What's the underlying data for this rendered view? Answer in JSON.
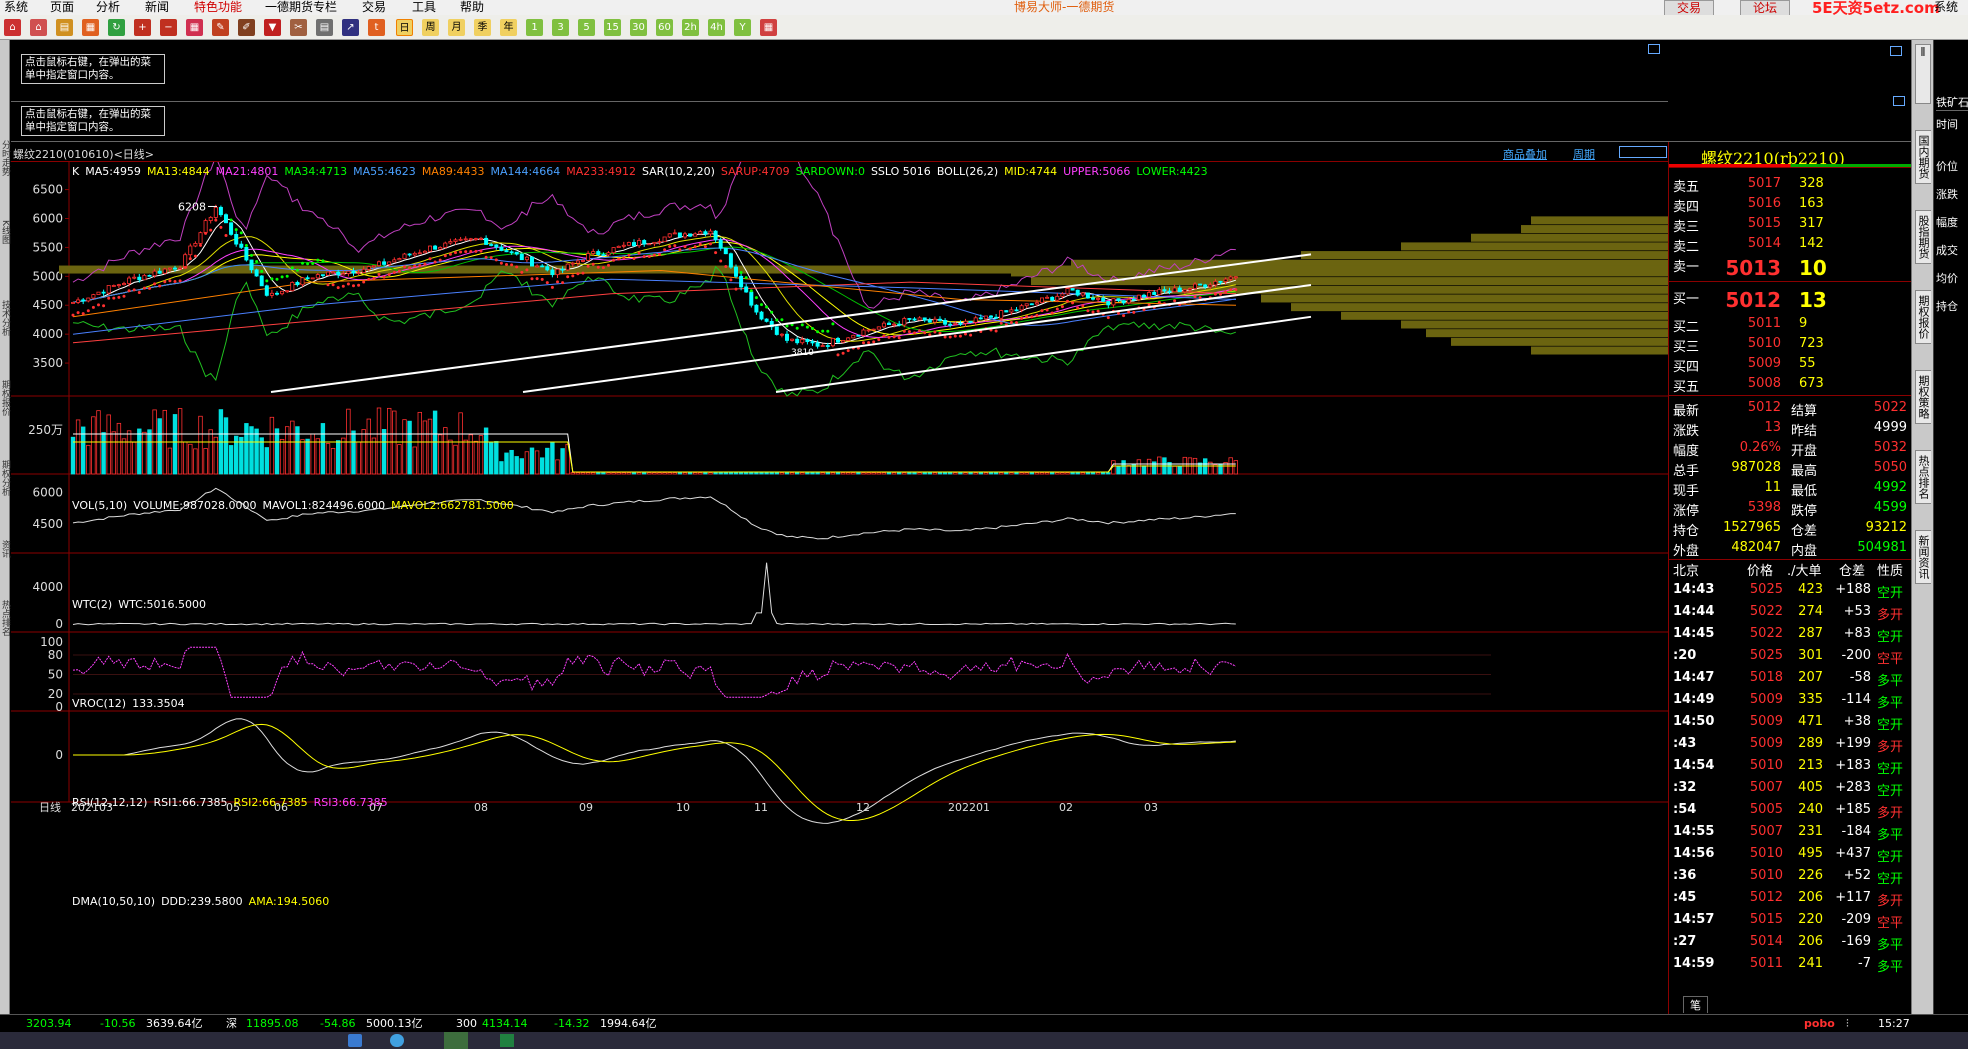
{
  "menu": [
    "系统",
    "页面",
    "分析",
    "新闻",
    "特色功能",
    "一德期货专栏",
    "交易",
    "工具",
    "帮助"
  ],
  "app_title": "博易大师-一德期货",
  "trade_btn": "交易",
  "forum_btn": "论坛",
  "watermark": "5E天资5etz.com",
  "system_right": "系统",
  "toolbar_periods": [
    "日",
    "周",
    "月",
    "季",
    "年",
    "1",
    "3",
    "5",
    "15",
    "30",
    "60",
    "2h",
    "4h",
    "Y"
  ],
  "notes": [
    "点击鼠标右键，在弹出的菜单中指定窗口内容。",
    "点击鼠标右键，在弹出的菜单中指定窗口内容。"
  ],
  "chart_header": {
    "symbol": "螺纹2210(010610)<日线>",
    "add_product": "商品叠加",
    "period": "周期"
  },
  "left_tabs": [
    "分时走势",
    "K线图",
    "技术分析",
    "期权报价",
    "期权分析",
    "资讯",
    "热点排名"
  ],
  "right_tabs": [
    "国内期货",
    "股指期货",
    "期权报价",
    "期权策略",
    "热点排名",
    "新闻资讯"
  ],
  "far_right": {
    "top": "铁矿石",
    "items": [
      "时间",
      "价位",
      "涨跌",
      "幅度",
      "成交",
      "均价",
      "持仓"
    ]
  },
  "colors": {
    "up": "#ff3030",
    "down": "#00ffff",
    "ma5": "#ffffff",
    "ma13": "#ffff00",
    "ma21": "#ff40ff",
    "ma34": "#00ff00",
    "ma55": "#4aa0ff",
    "ma89": "#ff8000",
    "ma144": "#4aa0ff",
    "ma233": "#ff3030"
  },
  "main_legend": [
    {
      "t": "K",
      "c": "wht"
    },
    {
      "t": "MA5:4959",
      "c": "wht"
    },
    {
      "t": "MA13:4844",
      "c": "yel"
    },
    {
      "t": "MA21:4801",
      "c": "mag"
    },
    {
      "t": "MA34:4713",
      "c": "grn"
    },
    {
      "t": "MA55:4623",
      "c": "blu"
    },
    {
      "t": "MA89:4433",
      "c": "org"
    },
    {
      "t": "MA144:4664",
      "c": "blu"
    },
    {
      "t": "MA233:4912",
      "c": "red"
    },
    {
      "t": "SAR(10,2,20)",
      "c": "wht"
    },
    {
      "t": "SARUP:4709",
      "c": "red"
    },
    {
      "t": "SARDOWN:0",
      "c": "grn"
    },
    {
      "t": "SSLO 5016",
      "c": "wht"
    },
    {
      "t": "BOLL(26,2)",
      "c": "wht"
    },
    {
      "t": "MID:4744",
      "c": "yel"
    },
    {
      "t": "UPPER:5066",
      "c": "mag"
    },
    {
      "t": "LOWER:4423",
      "c": "grn"
    }
  ],
  "vol_legend": [
    {
      "t": "VOL(5,10)",
      "c": "wht"
    },
    {
      "t": "VOLUME:987028.0000",
      "c": "wht"
    },
    {
      "t": "MAVOL1:824496.6000",
      "c": "wht"
    },
    {
      "t": "MAVOL2:662781.5000",
      "c": "yel"
    }
  ],
  "wtc_legend": [
    {
      "t": "WTC(2)",
      "c": "wht"
    },
    {
      "t": "WTC:5016.5000",
      "c": "wht"
    }
  ],
  "vroc_legend": [
    {
      "t": "VROC(12)",
      "c": "wht"
    },
    {
      "t": "133.3504",
      "c": "wht"
    }
  ],
  "rsi_legend": [
    {
      "t": "RSI(12,12,12)",
      "c": "wht"
    },
    {
      "t": "RSI1:66.7385",
      "c": "wht"
    },
    {
      "t": "RSI2:66.7385",
      "c": "yel"
    },
    {
      "t": "RSI3:66.7385",
      "c": "mag"
    }
  ],
  "dma_legend": [
    {
      "t": "DMA(10,50,10)",
      "c": "wht"
    },
    {
      "t": "DDD:239.5800",
      "c": "wht"
    },
    {
      "t": "AMA:194.5060",
      "c": "yel"
    }
  ],
  "y_main": [
    "6500",
    "6000",
    "5500",
    "5000",
    "4500",
    "4000",
    "3500"
  ],
  "y_vol": [
    "250万"
  ],
  "y_wtc": [
    "6000",
    "4500"
  ],
  "y_vroc": [
    "4000",
    "0"
  ],
  "y_rsi": [
    "100",
    "80",
    "50",
    "20",
    "0"
  ],
  "y_dma": [
    "0"
  ],
  "peak_label": "6208",
  "low_label": "3810",
  "x_label": "日线",
  "x_ticks": [
    "202103",
    "05",
    "06",
    "07",
    "08",
    "09",
    "10",
    "11",
    "12",
    "202201",
    "02",
    "03"
  ],
  "chart_data": {
    "type": "candlestick",
    "ylim": [
      3000,
      6700
    ],
    "x": [
      "202103",
      "05",
      "06",
      "07",
      "08",
      "09",
      "10",
      "11",
      "12",
      "202201",
      "02",
      "03"
    ],
    "close": [
      4950,
      5750,
      4900,
      5250,
      5450,
      5300,
      5750,
      3900,
      4250,
      4500,
      4750,
      5012
    ],
    "high": [
      5050,
      6208,
      5300,
      5400,
      5600,
      5500,
      5950,
      4900,
      4400,
      4650,
      4900,
      5050
    ],
    "low": [
      4500,
      4850,
      4600,
      5000,
      5100,
      5000,
      4700,
      3810,
      3900,
      4200,
      4450,
      4650
    ]
  },
  "quote": {
    "title": "螺纹2210(rb2210)",
    "asks": [
      {
        "l": "卖五",
        "p": "5017",
        "v": "328"
      },
      {
        "l": "卖四",
        "p": "5016",
        "v": "163"
      },
      {
        "l": "卖三",
        "p": "5015",
        "v": "317"
      },
      {
        "l": "卖二",
        "p": "5014",
        "v": "142"
      },
      {
        "l": "卖一",
        "p": "5013",
        "v": "10"
      }
    ],
    "bids": [
      {
        "l": "买一",
        "p": "5012",
        "v": "13"
      },
      {
        "l": "买二",
        "p": "5011",
        "v": "9"
      },
      {
        "l": "买三",
        "p": "5010",
        "v": "723"
      },
      {
        "l": "买四",
        "p": "5009",
        "v": "55"
      },
      {
        "l": "买五",
        "p": "5008",
        "v": "673"
      }
    ],
    "stats": [
      [
        "最新",
        "5012",
        "结算",
        "5022"
      ],
      [
        "涨跌",
        "13",
        "昨结",
        "4999"
      ],
      [
        "幅度",
        "0.26%",
        "开盘",
        "5032"
      ],
      [
        "总手",
        "987028",
        "最高",
        "5050"
      ],
      [
        "现手",
        "11",
        "最低",
        "4992"
      ],
      [
        "涨停",
        "5398",
        "跌停",
        "4599"
      ],
      [
        "持仓",
        "1527965",
        "仓差",
        "93212"
      ],
      [
        "外盘",
        "482047",
        "内盘",
        "504981"
      ]
    ],
    "tick_header": [
      "北京",
      "价格",
      "./大单",
      "仓差",
      "性质"
    ],
    "ticks": [
      [
        "14:43",
        "5025",
        "423",
        "+188",
        "空开"
      ],
      [
        "14:44",
        "5022",
        "274",
        "+53",
        "多开"
      ],
      [
        "14:45",
        "5022",
        "287",
        "+83",
        "空开"
      ],
      [
        ":20",
        "5025",
        "301",
        "-200",
        "空平"
      ],
      [
        "14:47",
        "5018",
        "207",
        "-58",
        "多平"
      ],
      [
        "14:49",
        "5009",
        "335",
        "-114",
        "多平"
      ],
      [
        "14:50",
        "5009",
        "471",
        "+38",
        "空开"
      ],
      [
        ":43",
        "5009",
        "289",
        "+199",
        "多开"
      ],
      [
        "14:54",
        "5010",
        "213",
        "+183",
        "空开"
      ],
      [
        ":32",
        "5007",
        "405",
        "+283",
        "空开"
      ],
      [
        ":54",
        "5005",
        "240",
        "+185",
        "多开"
      ],
      [
        "14:55",
        "5007",
        "231",
        "-184",
        "多平"
      ],
      [
        "14:56",
        "5010",
        "495",
        "+437",
        "空开"
      ],
      [
        ":36",
        "5010",
        "226",
        "+52",
        "空开"
      ],
      [
        ":45",
        "5012",
        "206",
        "+117",
        "多开"
      ],
      [
        "14:57",
        "5015",
        "220",
        "-209",
        "空平"
      ],
      [
        ":27",
        "5014",
        "206",
        "-169",
        "多平"
      ],
      [
        "14:59",
        "5011",
        "241",
        "-7",
        "多平"
      ]
    ],
    "bottom_tab": "笔"
  },
  "status": {
    "sh": "3203.94",
    "sh_chg": "-10.56",
    "sh_amt": "3639.64亿",
    "sz_name": "深",
    "sz": "11895.08",
    "sz_chg": "-54.86",
    "sz_amt": "5000.13亿",
    "hs_name": "300",
    "hs": "4134.14",
    "hs_chg": "-14.32",
    "hs_amt": "1994.64亿",
    "brand": "pobo",
    "time": "15:27"
  }
}
